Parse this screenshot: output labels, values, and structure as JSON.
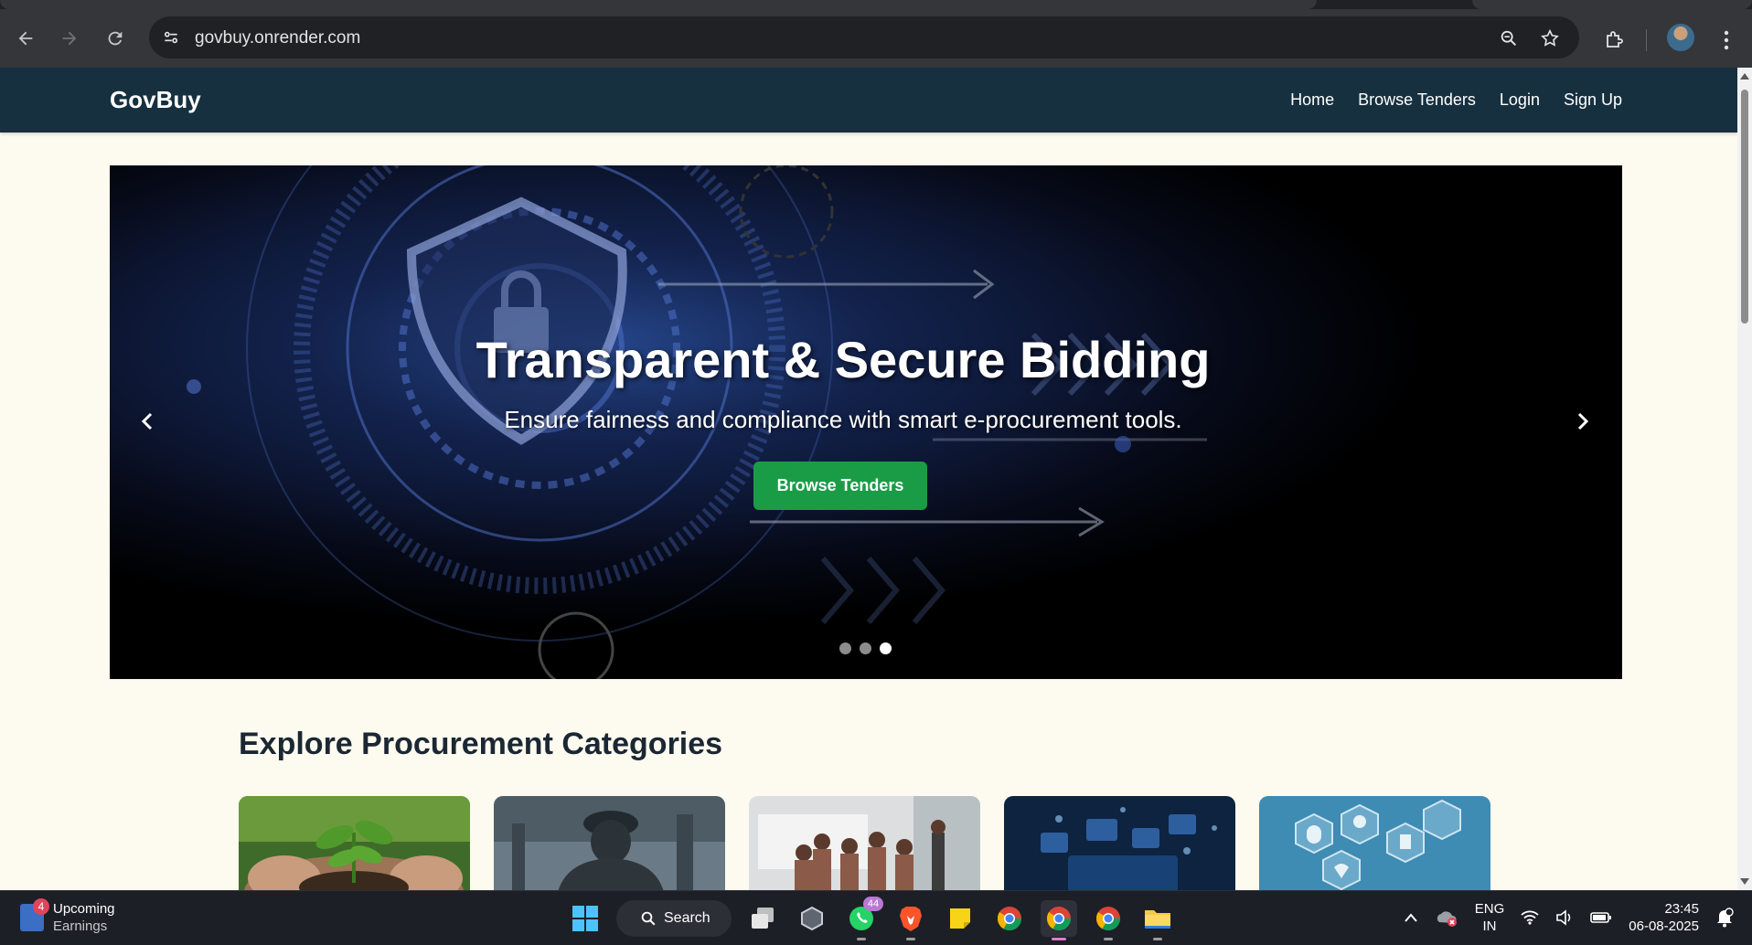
{
  "browser": {
    "url": "govbuy.onrender.com"
  },
  "site": {
    "brand": "GovBuy",
    "nav": [
      {
        "label": "Home"
      },
      {
        "label": "Browse Tenders"
      },
      {
        "label": "Login"
      },
      {
        "label": "Sign Up"
      }
    ]
  },
  "hero": {
    "title": "Transparent & Secure Bidding",
    "subtitle": "Ensure fairness and compliance with smart e-procurement tools.",
    "button": "Browse Tenders",
    "slides_count": 3,
    "active_slide": 3,
    "prev_icon": "chevron-left-icon",
    "next_icon": "chevron-right-icon"
  },
  "categories": {
    "heading": "Explore Procurement Categories",
    "cards": [
      {
        "image": "plant-in-hands"
      },
      {
        "image": "industrial-worker"
      },
      {
        "image": "classroom-students"
      },
      {
        "image": "digital-technology"
      },
      {
        "image": "healthcare-icons"
      }
    ]
  },
  "taskbar": {
    "weather_badge": "4",
    "weather_title": "Upcoming",
    "weather_sub": "Earnings",
    "search_label": "Search",
    "whatsapp_badge": "44",
    "lang_top": "ENG",
    "lang_bottom": "IN",
    "time": "23:45",
    "date": "06-08-2025"
  },
  "colors": {
    "navbar": "#16303f",
    "page_bg": "#fdfbf0",
    "button_green": "#1a9c47",
    "heading": "#1b2733"
  }
}
